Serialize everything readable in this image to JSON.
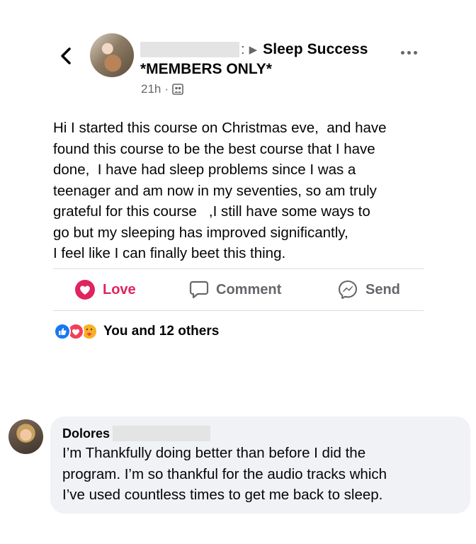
{
  "post": {
    "group_name_line1": "Sleep Success",
    "group_name_line2": "*MEMBERS ONLY*",
    "timestamp": "21h",
    "meta_separator": "·",
    "body_lines": [
      "Hi I started this course on Christmas eve,  and have",
      "found this course to be the best course that I have",
      "done,  I have had sleep problems since I was a",
      "teenager and am now in my seventies, so am truly",
      "grateful for this course   ,I still have some ways to",
      "go but my sleeping has improved significantly,",
      "I feel like I can finally beet this thing."
    ]
  },
  "actions": {
    "love_label": "Love",
    "comment_label": "Comment",
    "send_label": "Send"
  },
  "reactions": {
    "summary": "You and 12 others"
  },
  "comment": {
    "author": "Dolores",
    "lines": [
      "I’m Thankfully doing better than before I did the",
      "program. I’m so thankful for the audio tracks which",
      "I’ve used countless times to get me back to sleep."
    ]
  },
  "colors": {
    "love_red": "#e0245e",
    "like_blue": "#1877f2",
    "muted_text": "#65676b",
    "comment_bg": "#f0f2f5"
  },
  "icons": {
    "back": "chevron-left-icon",
    "more": "more-horizontal-icon",
    "audience": "group-audience-icon",
    "love": "love-heart-icon",
    "comment": "comment-bubble-icon",
    "send": "messenger-send-icon"
  }
}
